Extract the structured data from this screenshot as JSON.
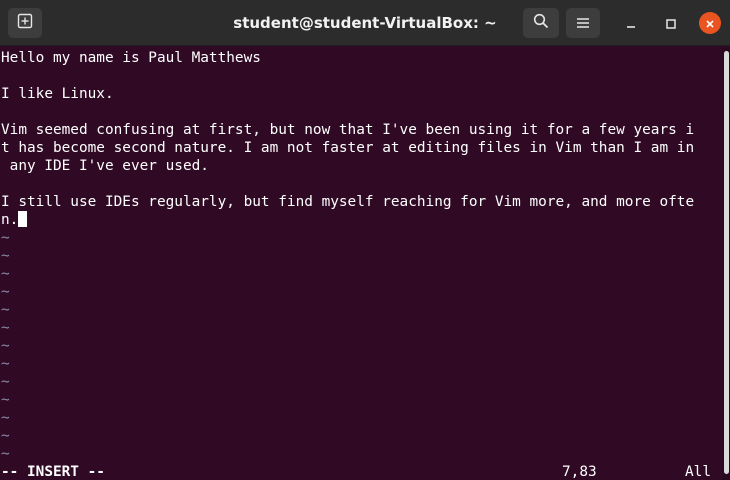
{
  "window": {
    "title": "student@student-VirtualBox: ~",
    "icons": {
      "new_tab": "new-tab-icon",
      "search": "search-icon",
      "menu": "hamburger-menu-icon",
      "minimize": "minimize-icon",
      "maximize": "maximize-icon",
      "close": "close-icon"
    },
    "colors": {
      "titlebar": "#2c2c2c",
      "close_button": "#e95420",
      "terminal_bg": "#300a24"
    }
  },
  "editor": {
    "lines": [
      "Hello my name is Paul Matthews",
      "",
      "I like Linux.",
      "",
      "Vim seemed confusing at first, but now that I've been using it for a few years i",
      "t has become second nature. I am not faster at editing files in Vim than I am in",
      " any IDE I've ever used.",
      "",
      "I still use IDEs regularly, but find myself reaching for Vim more, and more ofte",
      "n."
    ],
    "empty_line_marker": "~",
    "empty_line_count": 13
  },
  "status": {
    "mode": "-- INSERT --",
    "position": "7,83",
    "scroll": "All"
  }
}
